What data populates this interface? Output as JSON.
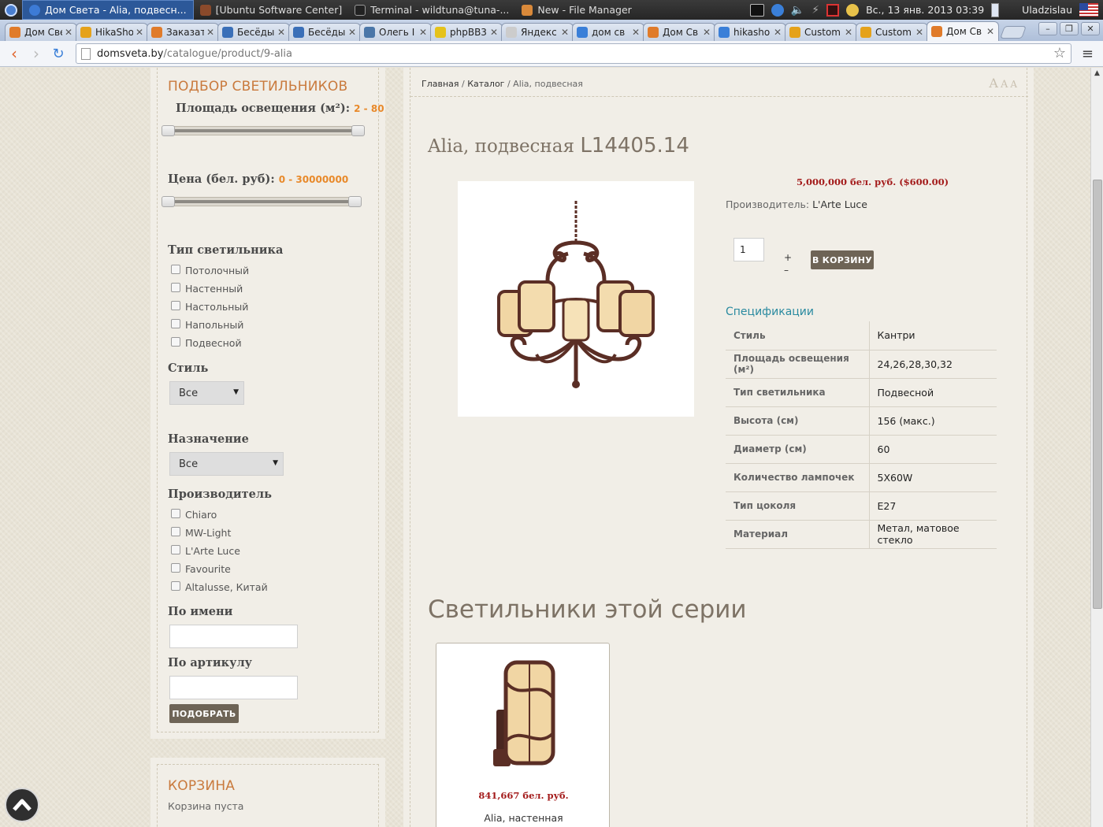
{
  "os": {
    "taskbar": [
      {
        "label": "Дом Света - Alia, подвесн...",
        "active": true,
        "color": "#3d7bd6"
      },
      {
        "label": "[Ubuntu Software Center]",
        "active": false,
        "color": "#8b4a2b"
      },
      {
        "label": "Terminal - wildtuna@tuna-...",
        "active": false,
        "color": "#222222"
      },
      {
        "label": "New - File Manager",
        "active": false,
        "color": "#d9893a"
      }
    ],
    "clock": "Вс., 13 янв. 2013 03:39",
    "user": "Uladzislau"
  },
  "browser": {
    "tabs": [
      {
        "label": "Дом Све",
        "color": "#e07b2a"
      },
      {
        "label": "HikaSho",
        "color": "#e5a21b"
      },
      {
        "label": "Заказать",
        "color": "#e07b2a"
      },
      {
        "label": "Бесёды",
        "color": "#3a6fb8"
      },
      {
        "label": "Бесёды",
        "color": "#3a6fb8"
      },
      {
        "label": "Олегь I",
        "color": "#4a76a8"
      },
      {
        "label": "phpBB3",
        "color": "#e5c21b"
      },
      {
        "label": "Яндекс",
        "color": "#cccccc"
      },
      {
        "label": "дом св",
        "color": "#3a7fd8"
      },
      {
        "label": "Дом Св",
        "color": "#e07b2a"
      },
      {
        "label": "hikasho",
        "color": "#3a7fd8"
      },
      {
        "label": "Custom",
        "color": "#e5a21b"
      },
      {
        "label": "Custom",
        "color": "#e5a21b"
      },
      {
        "label": "Дом Св",
        "color": "#e07b2a",
        "active": true
      }
    ],
    "url_host": "domsveta.by",
    "url_path": "/catalogue/product/9-alia"
  },
  "sidebar": {
    "title": "ПОДБОР СВЕТИЛЬНИКОВ",
    "area_label": "Площадь освещения (м²)",
    "area_range": "2 - 80",
    "area_min": 2,
    "area_max": 80,
    "price_label": "Цена (бел. руб)",
    "price_range": "0 - 30000000",
    "type_label": "Тип светильника",
    "types": [
      "Потолочный",
      "Настенный",
      "Настольный",
      "Напольный",
      "Подвесной"
    ],
    "style_label": "Стиль",
    "style_value": "Все",
    "purpose_label": "Назначение",
    "purpose_value": "Все",
    "maker_label": "Производитель",
    "makers": [
      "Chiaro",
      "MW-Light",
      "L'Arte Luce",
      "Favourite",
      "Altalusse, Китай"
    ],
    "by_name_label": "По имени",
    "by_sku_label": "По артикулу",
    "submit_label": "ПОДОБРАТЬ",
    "cart_title": "КОРЗИНА",
    "cart_empty": "Корзина пуста"
  },
  "breadcrumb": {
    "home": "Главная",
    "catalogue": "Каталог",
    "current": "Alia, подвесная"
  },
  "font_sizes": [
    "A",
    "A",
    "A"
  ],
  "product": {
    "name": "Alia, подвесная",
    "code": "L14405.14",
    "price": "5,000,000 бел. руб. ($600.00)",
    "maker_label": "Производитель:",
    "maker": "L'Arte Luce",
    "qty": "1",
    "plus": "+",
    "minus": "–",
    "add_to_cart": "В КОРЗИНУ",
    "specs_title": "Спецификации",
    "specs": [
      {
        "k": "Стиль",
        "v": "Кантри"
      },
      {
        "k": "Площадь освещения (м²)",
        "v": "24,26,28,30,32"
      },
      {
        "k": "Тип светильника",
        "v": "Подвесной"
      },
      {
        "k": "Высота (см)",
        "v": "156 (макс.)"
      },
      {
        "k": "Диаметр (см)",
        "v": "60"
      },
      {
        "k": "Количество лампочек",
        "v": "5X60W"
      },
      {
        "k": "Тип цоколя",
        "v": "E27"
      },
      {
        "k": "Материал",
        "v": "Метал, матовое стекло"
      }
    ]
  },
  "series": {
    "title": "Светильники этой серии",
    "items": [
      {
        "price": "841,667 бел. руб.",
        "name": "Alia, настенная"
      }
    ]
  },
  "colors": {
    "accent_orange": "#c97a3d",
    "price_red": "#a31a1a",
    "spec_teal": "#2a8aa0",
    "button_brown": "#6e6456"
  }
}
